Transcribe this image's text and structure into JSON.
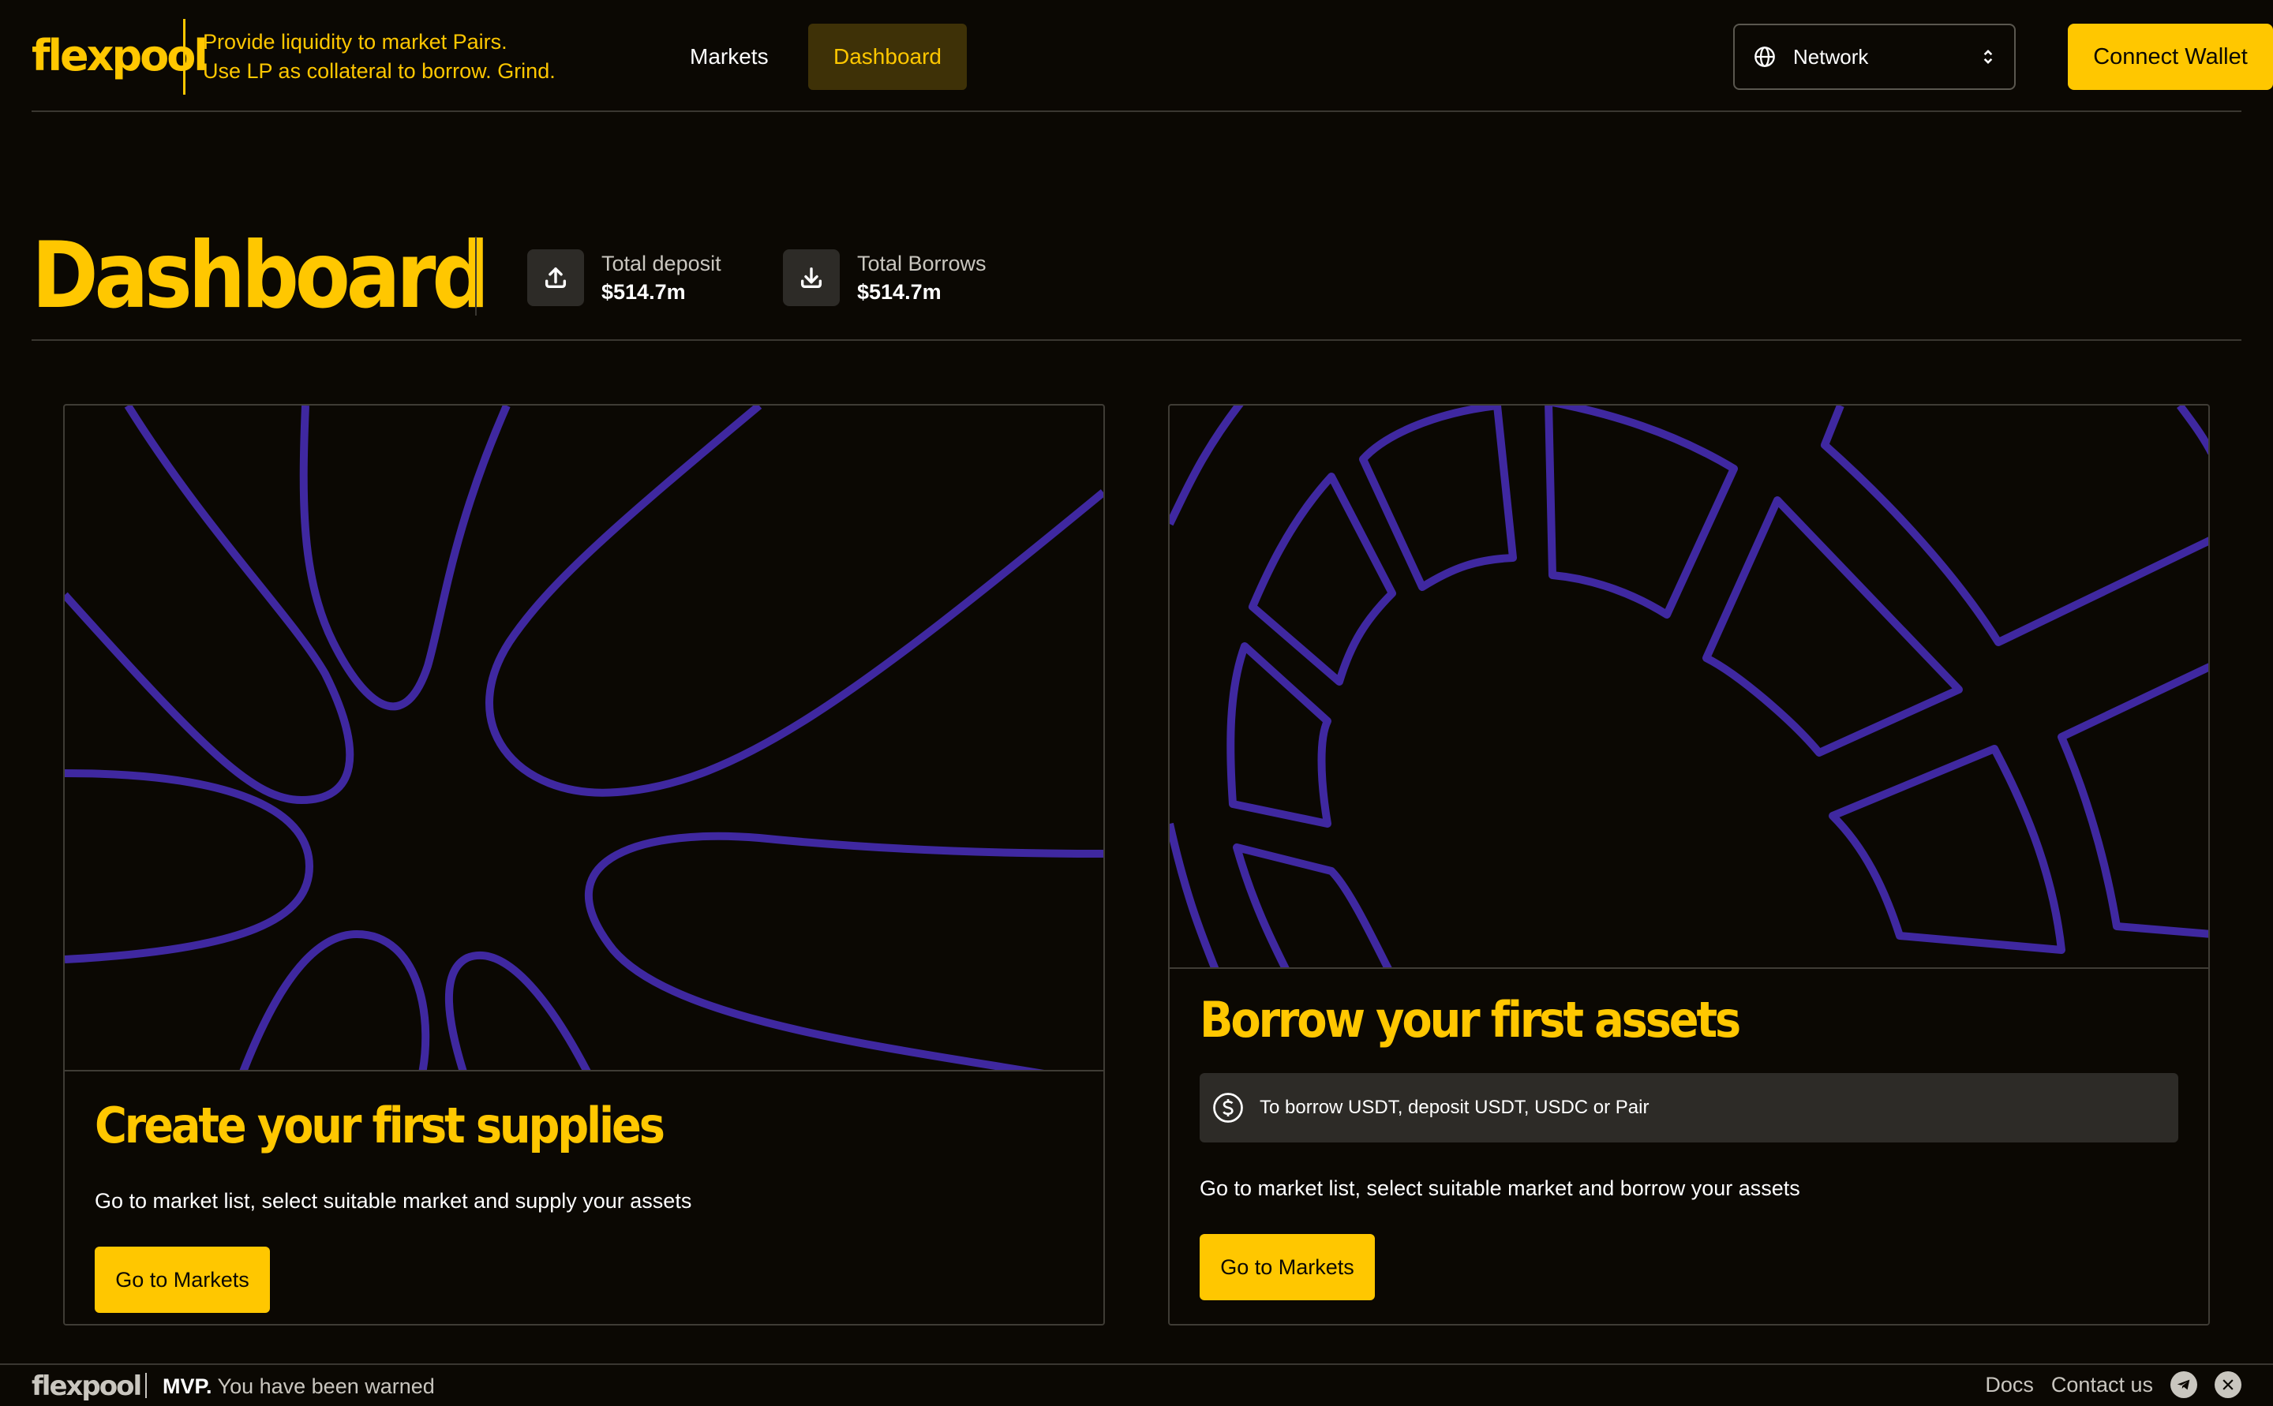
{
  "header": {
    "logo": "flexpool",
    "tagline_line1": "Provide liquidity to market Pairs.",
    "tagline_line2": "Use LP as collateral to borrow. Grind.",
    "nav": {
      "markets": "Markets",
      "dashboard": "Dashboard"
    },
    "network_label": "Network",
    "connect_wallet": "Connect Wallet"
  },
  "dashboard": {
    "title": "Dashboard",
    "total_deposit_label": "Total deposit",
    "total_deposit_value": "$514.7m",
    "total_borrows_label": "Total Borrows",
    "total_borrows_value": "$514.7m"
  },
  "supplies_card": {
    "title": "Create your first supplies",
    "description": "Go to market list, select suitable market and supply your assets",
    "button": "Go to Markets"
  },
  "borrow_card": {
    "title": "Borrow your first assets",
    "notice": "To borrow USDT, deposit USDT, USDC or Pair",
    "description": "Go to market list, select suitable market and borrow your assets",
    "button": "Go to Markets"
  },
  "footer": {
    "logo": "flexpool",
    "mvp": "MVP.",
    "warning": "You have been warned",
    "docs": "Docs",
    "contact": "Contact us"
  },
  "colors": {
    "background": "#0b0803",
    "accent": "#ffc700",
    "art_stroke": "#3f28a0",
    "border": "#3a3731"
  }
}
